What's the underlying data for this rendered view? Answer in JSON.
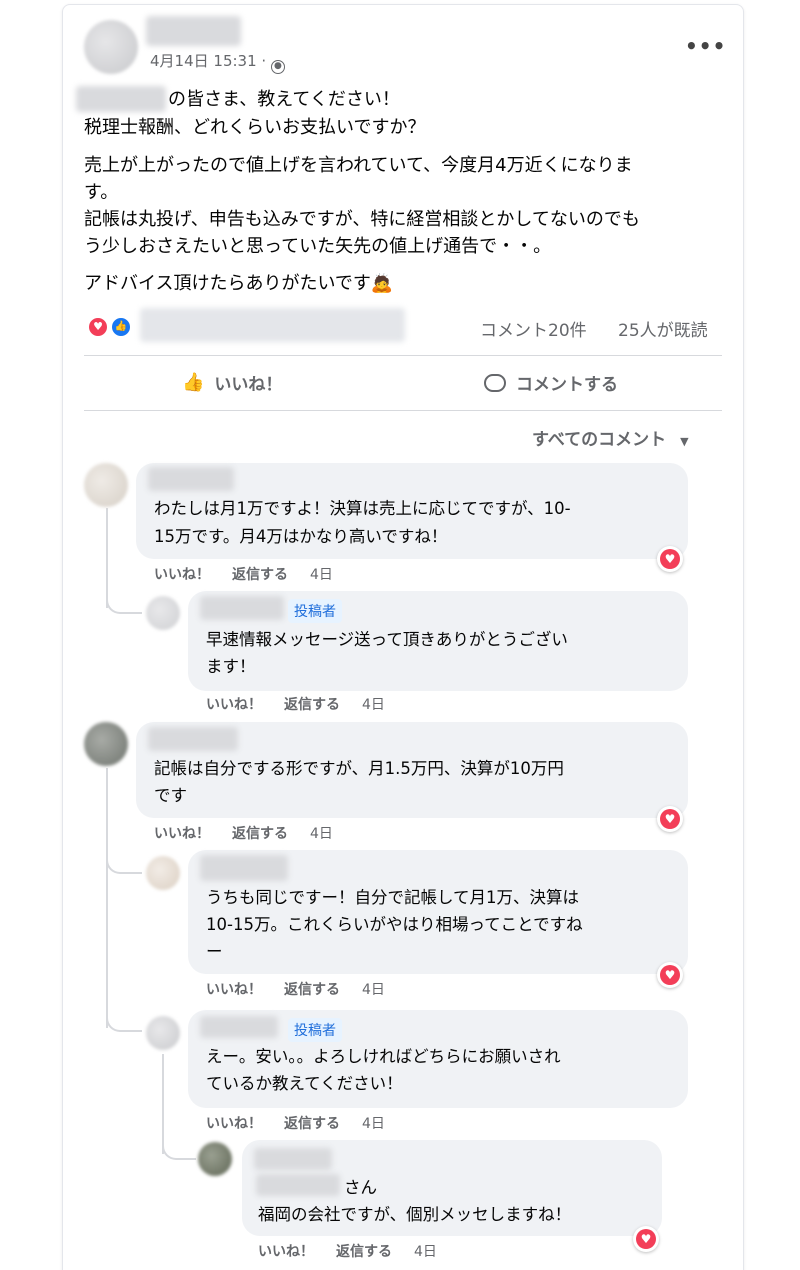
{
  "post": {
    "timestamp": "4月14日 15:31 ·",
    "group_suffix": "の皆さま、教えてください！",
    "lines": [
      "税理士報酬、どれくらいお支払いですか？",
      "売上が上がったので値上げを言われていて、今度月4万近くになりま",
      "す。",
      "記帳は丸投げ、申告も込みですが、特に経営相談とかしてないのでも",
      "う少しおさえたいと思っていた矢先の値上げ通告で・・。",
      "アドバイス頂けたらありがたいです"
    ],
    "emoji": "🙇",
    "comment_count": "コメント20件",
    "seen_count": "25人が既読"
  },
  "buttons": {
    "like": "いいね！",
    "comment": "コメントする"
  },
  "filter": {
    "label": "すべてのコメント"
  },
  "comments": [
    {
      "lines": [
        "わたしは月1万ですよ！決算は売上に応じてですが、10-",
        "15万です。月4万はかなり高いですね！"
      ],
      "like": "いいね！",
      "reply": "返信する",
      "date": "4日"
    },
    {
      "badge": "投稿者",
      "lines": [
        "早速情報メッセージ送って頂きありがとうござい",
        "ます！"
      ],
      "like": "いいね！",
      "reply": "返信する",
      "date": "4日"
    },
    {
      "lines": [
        "記帳は自分でする形ですが、月1.5万円、決算が10万円",
        "です"
      ],
      "like": "いいね！",
      "reply": "返信する",
      "date": "4日"
    },
    {
      "lines": [
        "うちも同じですー！自分で記帳して月1万、決算は",
        "10-15万。これくらいがやはり相場ってことですね",
        "ー"
      ],
      "like": "いいね！",
      "reply": "返信する",
      "date": "4日"
    },
    {
      "badge": "投稿者",
      "lines": [
        "えー。安い。。よろしければどちらにお願いされ",
        "ているか教えてください！"
      ],
      "like": "いいね！",
      "reply": "返信する",
      "date": "4日"
    },
    {
      "mention_suffix": "さん",
      "lines": [
        "福岡の会社ですが、個別メッセしますね！"
      ],
      "like": "いいね！",
      "reply": "返信する",
      "date": "4日"
    }
  ],
  "icons": {
    "more": "more-dots-icon",
    "privacy": "group-icon",
    "reaction_love": "heart-icon",
    "reaction_like": "thumb-icon",
    "like_button": "thumbs-up-icon",
    "comment_button": "speech-bubble-icon",
    "dropdown": "caret-down-icon"
  },
  "colors": {
    "love": "#f33e58",
    "like": "#1877f2",
    "bubble": "#f0f2f5",
    "meta": "#65676b",
    "badge_text": "#216fdb",
    "badge_bg": "#e7f3ff"
  }
}
